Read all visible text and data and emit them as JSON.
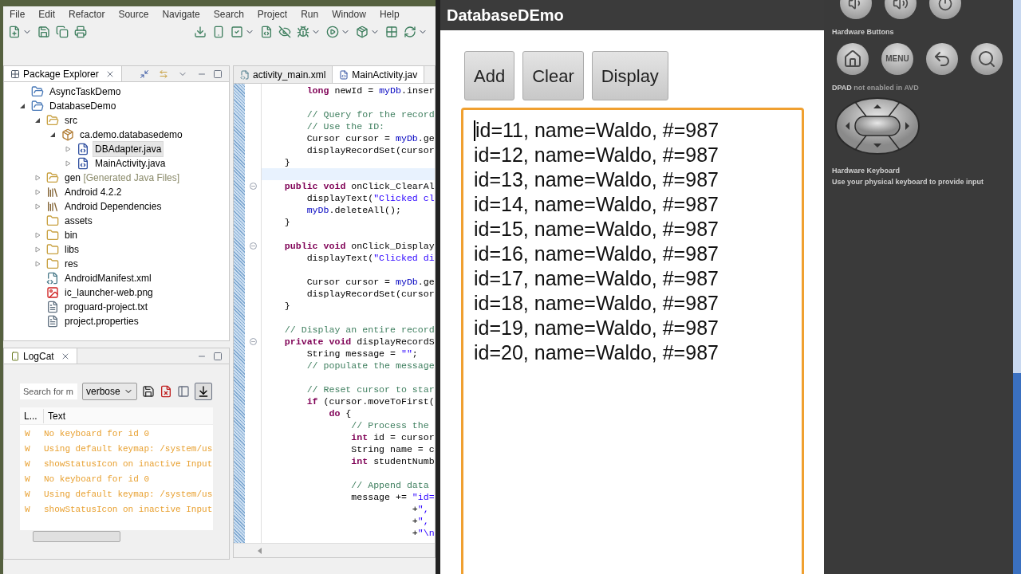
{
  "ide": {
    "menu": [
      "File",
      "Edit",
      "Refactor",
      "Source",
      "Navigate",
      "Search",
      "Project",
      "Run",
      "Window",
      "Help"
    ],
    "package_explorer": {
      "title": "Package Explorer",
      "tree": [
        {
          "label": "AsyncTaskDemo",
          "kind": "project",
          "selected": false
        },
        {
          "label": "DatabaseDemo",
          "kind": "project",
          "expanded": true,
          "selected": false,
          "children": [
            {
              "label": "src",
              "kind": "src",
              "expanded": true,
              "selected": false,
              "children": [
                {
                  "label": "ca.demo.databasedemo",
                  "kind": "package",
                  "expanded": true,
                  "selected": false,
                  "children": [
                    {
                      "label": "DBAdapter.java",
                      "kind": "java",
                      "expanded": false,
                      "selected": true
                    },
                    {
                      "label": "MainActivity.java",
                      "kind": "java",
                      "expanded": false,
                      "selected": false
                    }
                  ]
                }
              ]
            },
            {
              "label": "gen",
              "note": "[Generated Java Files]",
              "kind": "src",
              "expanded": false,
              "selected": false
            },
            {
              "label": "Android 4.2.2",
              "kind": "library",
              "expanded": false,
              "selected": false
            },
            {
              "label": "Android Dependencies",
              "kind": "library",
              "expanded": false,
              "selected": false
            },
            {
              "label": "assets",
              "kind": "folder",
              "selected": false
            },
            {
              "label": "bin",
              "kind": "folder",
              "expanded": false,
              "selected": false
            },
            {
              "label": "libs",
              "kind": "folder",
              "expanded": false,
              "selected": false
            },
            {
              "label": "res",
              "kind": "folder",
              "expanded": false,
              "selected": false
            },
            {
              "label": "AndroidManifest.xml",
              "kind": "xml",
              "selected": false
            },
            {
              "label": "ic_launcher-web.png",
              "kind": "image",
              "selected": false
            },
            {
              "label": "proguard-project.txt",
              "kind": "text",
              "selected": false
            },
            {
              "label": "project.properties",
              "kind": "text",
              "selected": false
            }
          ]
        }
      ]
    },
    "editor": {
      "tabs": [
        {
          "label": "activity_main.xml",
          "kind": "xml",
          "selected": false
        },
        {
          "label": "MainActivity.jav",
          "kind": "java",
          "selected": true
        }
      ],
      "lines": [
        {
          "kind": "code",
          "segments": [
            {
              "kind": "keyword",
              "text": "        long"
            },
            {
              "kind": "plain",
              "text": " newId = "
            },
            {
              "kind": "field",
              "text": "myDb"
            },
            {
              "kind": "plain",
              "text": ".inser"
            }
          ]
        },
        {
          "kind": "blank"
        },
        {
          "kind": "code",
          "segments": [
            {
              "kind": "comment",
              "text": "        // Query for the record"
            }
          ]
        },
        {
          "kind": "code",
          "segments": [
            {
              "kind": "comment",
              "text": "        // Use the ID:"
            }
          ]
        },
        {
          "kind": "code",
          "segments": [
            {
              "kind": "plain",
              "text": "        Cursor cursor = "
            },
            {
              "kind": "field",
              "text": "myDb"
            },
            {
              "kind": "plain",
              "text": ".ge"
            }
          ]
        },
        {
          "kind": "code",
          "segments": [
            {
              "kind": "plain",
              "text": "        displayRecordSet(cursor"
            }
          ]
        },
        {
          "kind": "code",
          "segments": [
            {
              "kind": "plain",
              "text": "    }"
            }
          ]
        },
        {
          "kind": "blank",
          "current": true
        },
        {
          "kind": "code",
          "fold": true,
          "segments": [
            {
              "kind": "keyword",
              "text": "    public void"
            },
            {
              "kind": "plain",
              "text": " onClick_ClearAl"
            }
          ]
        },
        {
          "kind": "code",
          "segments": [
            {
              "kind": "plain",
              "text": "        displayText("
            },
            {
              "kind": "string",
              "text": "\"Clicked cl"
            }
          ]
        },
        {
          "kind": "code",
          "segments": [
            {
              "kind": "field",
              "text": "        myDb"
            },
            {
              "kind": "plain",
              "text": ".deleteAll();"
            }
          ]
        },
        {
          "kind": "code",
          "segments": [
            {
              "kind": "plain",
              "text": "    }"
            }
          ]
        },
        {
          "kind": "blank"
        },
        {
          "kind": "code",
          "fold": true,
          "segments": [
            {
              "kind": "keyword",
              "text": "    public void"
            },
            {
              "kind": "plain",
              "text": " onClick_Display"
            }
          ]
        },
        {
          "kind": "code",
          "segments": [
            {
              "kind": "plain",
              "text": "        displayText("
            },
            {
              "kind": "string",
              "text": "\"Clicked di"
            }
          ]
        },
        {
          "kind": "blank"
        },
        {
          "kind": "code",
          "segments": [
            {
              "kind": "plain",
              "text": "        Cursor cursor = "
            },
            {
              "kind": "field",
              "text": "myDb"
            },
            {
              "kind": "plain",
              "text": ".ge"
            }
          ]
        },
        {
          "kind": "code",
          "segments": [
            {
              "kind": "plain",
              "text": "        displayRecordSet(cursor"
            }
          ]
        },
        {
          "kind": "code",
          "segments": [
            {
              "kind": "plain",
              "text": "    }"
            }
          ]
        },
        {
          "kind": "blank"
        },
        {
          "kind": "code",
          "segments": [
            {
              "kind": "comment",
              "text": "    // Display an entire record"
            }
          ]
        },
        {
          "kind": "code",
          "fold": true,
          "segments": [
            {
              "kind": "keyword",
              "text": "    private void"
            },
            {
              "kind": "plain",
              "text": " displayRecordS"
            }
          ]
        },
        {
          "kind": "code",
          "segments": [
            {
              "kind": "plain",
              "text": "        String message = "
            },
            {
              "kind": "string",
              "text": "\"\""
            },
            {
              "kind": "plain",
              "text": ";"
            }
          ]
        },
        {
          "kind": "code",
          "segments": [
            {
              "kind": "comment",
              "text": "        // populate the message"
            }
          ]
        },
        {
          "kind": "blank"
        },
        {
          "kind": "code",
          "segments": [
            {
              "kind": "comment",
              "text": "        // Reset cursor to star"
            }
          ]
        },
        {
          "kind": "code",
          "segments": [
            {
              "kind": "keyword",
              "text": "        if"
            },
            {
              "kind": "plain",
              "text": " (cursor.moveToFirst("
            }
          ]
        },
        {
          "kind": "code",
          "segments": [
            {
              "kind": "keyword",
              "text": "            do"
            },
            {
              "kind": "plain",
              "text": " {"
            }
          ]
        },
        {
          "kind": "code",
          "segments": [
            {
              "kind": "comment",
              "text": "                // Process the"
            }
          ]
        },
        {
          "kind": "code",
          "segments": [
            {
              "kind": "keyword",
              "text": "                int"
            },
            {
              "kind": "plain",
              "text": " id = cursor"
            }
          ]
        },
        {
          "kind": "code",
          "segments": [
            {
              "kind": "plain",
              "text": "                String name = c"
            }
          ]
        },
        {
          "kind": "code",
          "segments": [
            {
              "kind": "keyword",
              "text": "                int"
            },
            {
              "kind": "plain",
              "text": " studentNumb"
            }
          ]
        },
        {
          "kind": "blank"
        },
        {
          "kind": "code",
          "segments": [
            {
              "kind": "comment",
              "text": "                // Append data"
            }
          ]
        },
        {
          "kind": "code",
          "segments": [
            {
              "kind": "plain",
              "text": "                message += "
            },
            {
              "kind": "string",
              "text": "\"id="
            }
          ]
        },
        {
          "kind": "code",
          "segments": [
            {
              "kind": "plain",
              "text": "                           +"
            },
            {
              "kind": "string",
              "text": "\","
            }
          ]
        },
        {
          "kind": "code",
          "segments": [
            {
              "kind": "plain",
              "text": "                           +"
            },
            {
              "kind": "string",
              "text": "\","
            }
          ]
        },
        {
          "kind": "code",
          "segments": [
            {
              "kind": "plain",
              "text": "                           +"
            },
            {
              "kind": "string",
              "text": "\"\\n"
            }
          ]
        }
      ]
    },
    "logcat": {
      "title": "LogCat",
      "search": {
        "placeholder": "Search for m"
      },
      "level_select": "verbose",
      "columns": [
        "L...",
        "Text"
      ],
      "rows": [
        {
          "level": "W",
          "text": "No keyboard for id 0"
        },
        {
          "level": "W",
          "text": "Using default keymap: /system/us"
        },
        {
          "level": "W",
          "text": "showStatusIcon on inactive Input"
        },
        {
          "level": "W",
          "text": "No keyboard for id 0"
        },
        {
          "level": "W",
          "text": "Using default keymap: /system/us"
        },
        {
          "level": "W",
          "text": "showStatusIcon on inactive Input"
        }
      ]
    }
  },
  "emulator": {
    "app_title": "DatabaseDEmo",
    "buttons": [
      "Add",
      "Clear",
      "Display"
    ],
    "records": [
      "id=11, name=Waldo, #=987",
      "id=12, name=Waldo, #=987",
      "id=13, name=Waldo, #=987",
      "id=14, name=Waldo, #=987",
      "id=15, name=Waldo, #=987",
      "id=16, name=Waldo, #=987",
      "id=17, name=Waldo, #=987",
      "id=18, name=Waldo, #=987",
      "id=19, name=Waldo, #=987",
      "id=20, name=Waldo, #=987"
    ],
    "controls": {
      "hardware_buttons_label": "Hardware Buttons",
      "menu_key": "MENU",
      "dpad_label": "DPAD",
      "dpad_note": "not enabled in AVD",
      "keyboard_title": "Hardware Keyboard",
      "keyboard_note": "Use your physical keyboard to provide input"
    }
  }
}
